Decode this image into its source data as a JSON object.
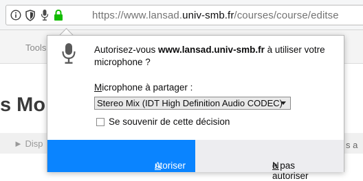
{
  "browser": {
    "url_prefix": "https://www.lansad.",
    "url_domain": "univ-smb.fr",
    "url_suffix": "/courses/course/editse"
  },
  "page": {
    "nav_tools": "Tools",
    "heading": "s Mo",
    "disp_label": "Disp",
    "right_fragment": "s a"
  },
  "popup": {
    "message_before": "Autorisez-vous ",
    "message_site": "www.lansad.univ-smb.fr",
    "message_after": " à utiliser votre microphone ?",
    "device_label_key": "M",
    "device_label_rest": "icrophone à partager :",
    "device_selected": "Stereo Mix (IDT High Definition Audio CODEC)",
    "remember_label": "Se souvenir de cette décision",
    "allow_key": "A",
    "allow_rest": "utoriser",
    "deny_key": "N",
    "deny_rest": "e pas autoriser"
  },
  "colors": {
    "accent": "#0a84ff",
    "lock_green": "#12bc00"
  },
  "icons": [
    "info-icon",
    "shield-icon",
    "microphone-icon",
    "lock-icon",
    "chevron-down-icon"
  ]
}
